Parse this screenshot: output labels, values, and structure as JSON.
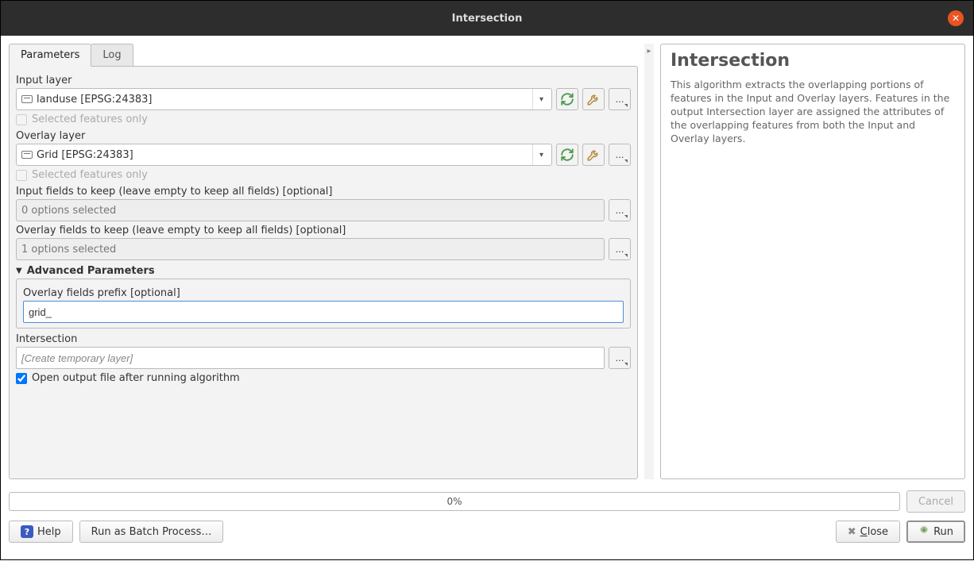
{
  "window": {
    "title": "Intersection"
  },
  "tabs": {
    "parameters": "Parameters",
    "log": "Log"
  },
  "params": {
    "input_layer_label": "Input layer",
    "input_layer_value": "landuse [EPSG:24383]",
    "selected_only": "Selected features only",
    "overlay_layer_label": "Overlay layer",
    "overlay_layer_value": "Grid [EPSG:24383]",
    "input_fields_label": "Input fields to keep (leave empty to keep all fields) [optional]",
    "input_fields_value": "0 options selected",
    "overlay_fields_label": "Overlay fields to keep (leave empty to keep all fields) [optional]",
    "overlay_fields_value": "1 options selected",
    "advanced_label": "Advanced Parameters",
    "prefix_label": "Overlay fields prefix [optional]",
    "prefix_value": "grid_",
    "output_label": "Intersection",
    "output_placeholder": "[Create temporary layer]",
    "open_output_label": "Open output file after running algorithm"
  },
  "help": {
    "title": "Intersection",
    "body": "This algorithm extracts the overlapping portions of features in the Input and Overlay layers. Features in the output Intersection layer are assigned the attributes of the overlapping features from both the Input and Overlay layers."
  },
  "progress": {
    "text": "0%"
  },
  "buttons": {
    "cancel": "Cancel",
    "help": "Help",
    "batch": "Run as Batch Process…",
    "close": "Close",
    "run": "Run",
    "dots": "…"
  }
}
